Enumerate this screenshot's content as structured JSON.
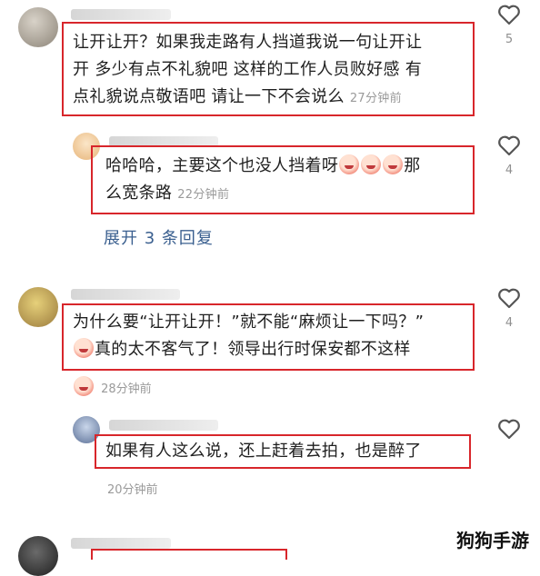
{
  "comments": [
    {
      "text_lines": [
        "让开让开？如果我走路有人挡道我说一句让开让",
        "开 多少有点不礼貌吧 这样的工作人员败好感 有",
        "点礼貌说点敬语吧 请让一下不会说么"
      ],
      "time": "27分钟前",
      "likes": "5"
    },
    {
      "text_lines": [
        "哈哈哈，主要这个也没人挡着呀",
        "那",
        "么宽条路"
      ],
      "time": "22分钟前",
      "likes": "4",
      "emoji_count": "3"
    },
    {
      "text_lines": [
        "为什么要“让开让开！”就不能“麻烦让一下吗？”",
        "真的太不客气了！领导出行时保安都不这样"
      ],
      "time": "28分钟前",
      "likes": "4"
    },
    {
      "text_lines": [
        "如果有人这么说，还上赶着去拍，也是醉了"
      ],
      "time": "20分钟前",
      "likes": ""
    }
  ],
  "expand_replies": "展开 3 条回复",
  "watermark": "狗狗手游",
  "icons": {
    "like": "heart-outline-icon",
    "emoji": "crying-laugh-emoji-icon"
  },
  "colors": {
    "highlight_box": "#d8262b",
    "link": "#3a5f8f",
    "meta": "#9a9a9a"
  }
}
